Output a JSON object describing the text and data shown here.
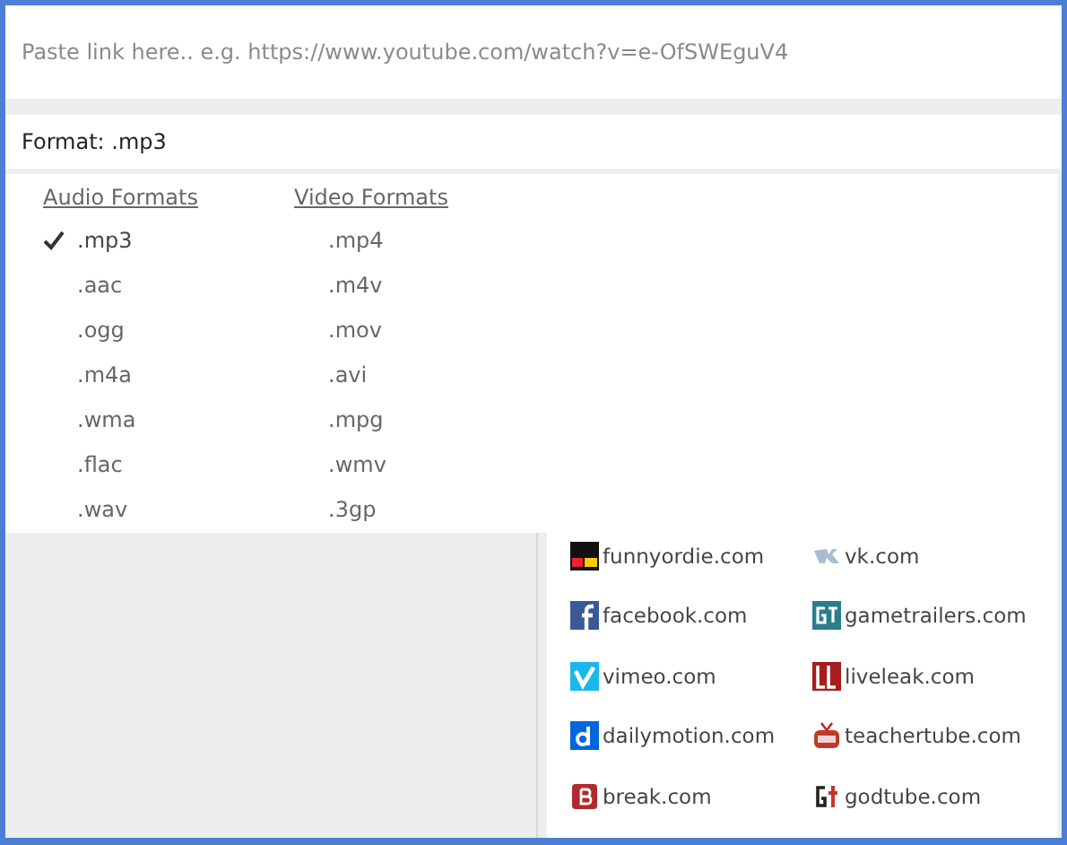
{
  "url_field": {
    "placeholder": "Paste link here.. e.g. https://www.youtube.com/watch?v=e-OfSWEguV4"
  },
  "format": {
    "label": "Format: .mp3"
  },
  "format_menu": {
    "groups": [
      {
        "heading": "Audio Formats",
        "options": [
          {
            "label": ".mp3",
            "selected": true
          },
          {
            "label": ".aac",
            "selected": false
          },
          {
            "label": ".ogg",
            "selected": false
          },
          {
            "label": ".m4a",
            "selected": false
          },
          {
            "label": ".wma",
            "selected": false
          },
          {
            "label": ".flac",
            "selected": false
          },
          {
            "label": ".wav",
            "selected": false
          }
        ]
      },
      {
        "heading": "Video Formats",
        "options": [
          {
            "label": ".mp4",
            "selected": false
          },
          {
            "label": ".m4v",
            "selected": false
          },
          {
            "label": ".mov",
            "selected": false
          },
          {
            "label": ".avi",
            "selected": false
          },
          {
            "label": ".mpg",
            "selected": false
          },
          {
            "label": ".wmv",
            "selected": false
          },
          {
            "label": ".3gp",
            "selected": false
          }
        ]
      }
    ]
  },
  "sites": [
    {
      "label": "funnyordie.com",
      "kind": "funnyordie"
    },
    {
      "label": "vk.com",
      "kind": "vk"
    },
    {
      "label": "facebook.com",
      "kind": "facebook"
    },
    {
      "label": "gametrailers.com",
      "kind": "gametrailers"
    },
    {
      "label": "vimeo.com",
      "kind": "vimeo"
    },
    {
      "label": "liveleak.com",
      "kind": "liveleak"
    },
    {
      "label": "dailymotion.com",
      "kind": "dailymotion"
    },
    {
      "label": "teachertube.com",
      "kind": "teachertube"
    },
    {
      "label": "break.com",
      "kind": "break"
    },
    {
      "label": "godtube.com",
      "kind": "godtube"
    }
  ]
}
